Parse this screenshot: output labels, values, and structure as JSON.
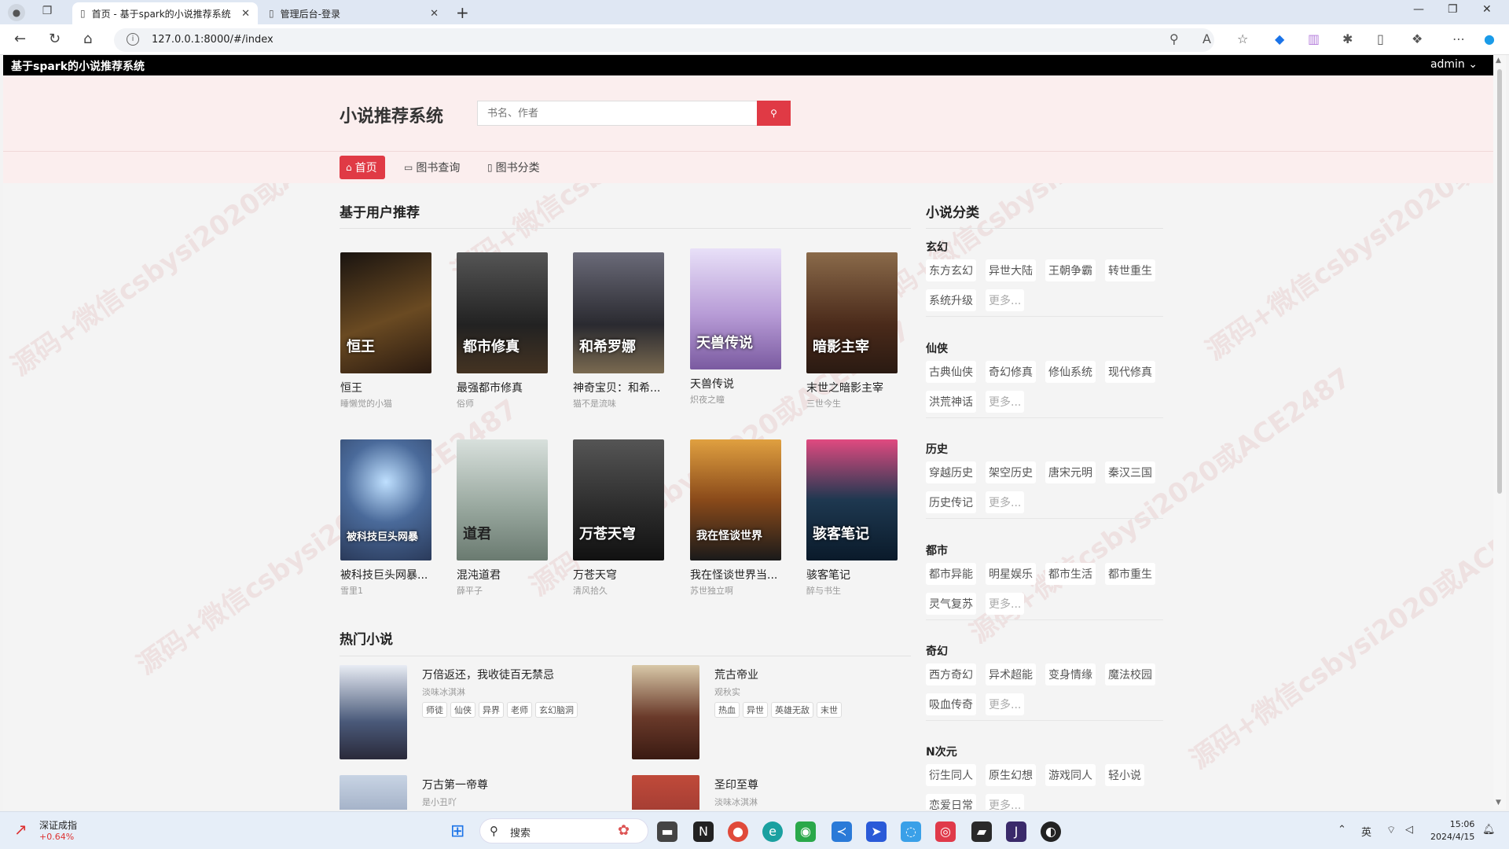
{
  "browser": {
    "tabs": [
      {
        "label": "首页 - 基于spark的小说推荐系统",
        "active": true
      },
      {
        "label": "管理后台-登录",
        "active": false
      }
    ],
    "url": "127.0.0.1:8000/#/index"
  },
  "site": {
    "brand": "基于spark的小说推荐系统",
    "user": "admin",
    "logo": "小说推荐系统",
    "search_placeholder": "书名、作者",
    "nav": [
      "首页",
      "图书查询",
      "图书分类"
    ]
  },
  "recommend": {
    "title": "基于用户推荐",
    "books": [
      {
        "title": "恒王",
        "author": "睡懒觉的小猫",
        "cover_text": "恒王",
        "color": "#3a2a1a"
      },
      {
        "title": "最强都市修真",
        "author": "俗师",
        "cover_text": "都市修真",
        "color": "#2b2b2b"
      },
      {
        "title": "神奇宝贝：和希...",
        "author": "猫不是流味",
        "cover_text": "和希罗娜",
        "color": "#4a4a58"
      },
      {
        "title": "天兽传说",
        "author": "炽夜之瞳",
        "cover_text": "天兽传说",
        "color": "#b79bd6"
      },
      {
        "title": "末世之暗影主宰",
        "author": "三世今生",
        "cover_text": "暗影主宰",
        "color": "#5a3a28"
      },
      {
        "title": "被科技巨头网暴...",
        "author": "雪里1",
        "cover_text": "被科技巨头网暴",
        "color": "#4a6a9a"
      },
      {
        "title": "混沌道君",
        "author": "薛平子",
        "cover_text": "道君",
        "color": "#9aa9a0"
      },
      {
        "title": "万苍天穹",
        "author": "清风拾久",
        "cover_text": "万苍天穹",
        "color": "#3a3a3a"
      },
      {
        "title": "我在怪谈世界当...",
        "author": "苏世独立啊",
        "cover_text": "我在怪谈世界",
        "color": "#8a4a1a"
      },
      {
        "title": "骇客笔记",
        "author": "醉与书生",
        "cover_text": "骇客笔记",
        "color": "#1e3850"
      }
    ]
  },
  "hot": {
    "title": "热门小说",
    "items": [
      {
        "title": "万倍返还，我收徒百无禁忌",
        "author": "淡味冰淇淋",
        "tags": [
          "师徒",
          "仙侠",
          "异界",
          "老师",
          "玄幻脑洞"
        ],
        "color": "#4a5a7a"
      },
      {
        "title": "荒古帝业",
        "author": "观秋实",
        "tags": [
          "热血",
          "异世",
          "英雄无敌",
          "末世"
        ],
        "color": "#6a3a2a"
      },
      {
        "title": "万古第一帝尊",
        "author": "是小丑吖",
        "tags": [],
        "color": "#6a7a9a"
      },
      {
        "title": "圣印至尊",
        "author": "淡味冰淇淋",
        "tags": [],
        "color": "#7a2a2a"
      }
    ]
  },
  "categories": {
    "title": "小说分类",
    "groups": [
      {
        "name": "玄幻",
        "tags": [
          "东方玄幻",
          "异世大陆",
          "王朝争霸",
          "转世重生",
          "系统升级",
          "更多..."
        ]
      },
      {
        "name": "仙侠",
        "tags": [
          "古典仙侠",
          "奇幻修真",
          "修仙系统",
          "现代修真",
          "洪荒神话",
          "更多..."
        ]
      },
      {
        "name": "历史",
        "tags": [
          "穿越历史",
          "架空历史",
          "唐宋元明",
          "秦汉三国",
          "历史传记",
          "更多..."
        ]
      },
      {
        "name": "都市",
        "tags": [
          "都市异能",
          "明星娱乐",
          "都市生活",
          "都市重生",
          "灵气复苏",
          "更多..."
        ]
      },
      {
        "name": "奇幻",
        "tags": [
          "西方奇幻",
          "异术超能",
          "变身情缘",
          "魔法校园",
          "吸血传奇",
          "更多..."
        ]
      },
      {
        "name": "N次元",
        "tags": [
          "衍生同人",
          "原生幻想",
          "游戏同人",
          "轻小说",
          "恋爱日常",
          "更多..."
        ]
      }
    ]
  },
  "taskbar": {
    "stock_name": "深证成指",
    "stock_change": "+0.64%",
    "search_label": "搜索",
    "ime": "英",
    "time": "15:06",
    "date": "2024/4/15"
  },
  "watermark": "源码+微信csbysi2020或ACE2487"
}
